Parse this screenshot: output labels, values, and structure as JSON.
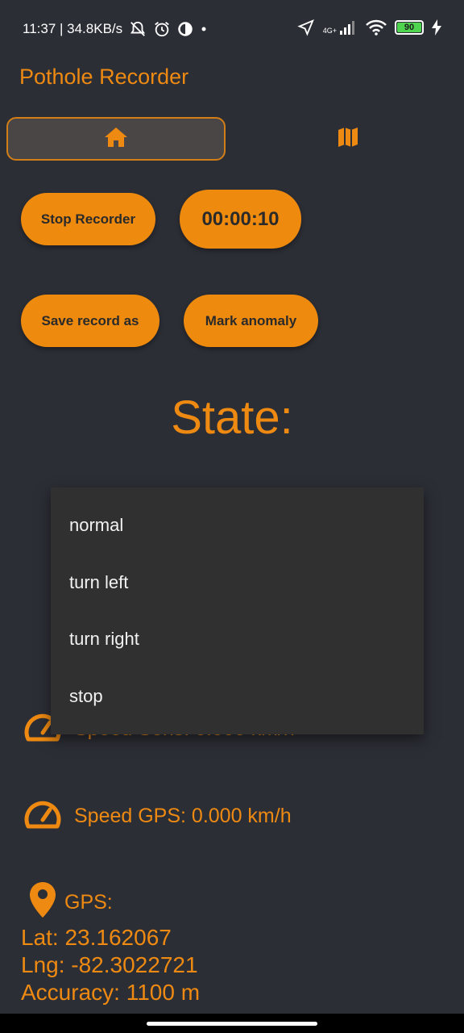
{
  "status_bar": {
    "time_and_speed": "11:37 | 34.8KB/s",
    "network": "4G+",
    "battery": "90"
  },
  "app": {
    "title": "Pothole Recorder",
    "tabs": [
      {
        "icon": "home-icon",
        "selected": true
      },
      {
        "icon": "map-icon",
        "selected": false
      }
    ]
  },
  "controls": {
    "stop_label": "Stop Recorder",
    "timer": "00:00:10",
    "save_label": "Save record as",
    "mark_label": "Mark anomaly"
  },
  "state": {
    "label": "State:"
  },
  "dropdown": {
    "options": [
      "normal",
      "turn left",
      "turn right",
      "stop"
    ]
  },
  "readings": {
    "speed_sensor": "Speed Sens:  0.000  km/h",
    "speed_gps": "Speed GPS:  0.000  km/h",
    "gps_label": "GPS:",
    "lat": "Lat:  23.162067",
    "lng": "Lng:  -82.3022721",
    "accuracy": "Accuracy: 1100 m"
  },
  "colors": {
    "accent": "#ee8a12",
    "background": "#2c2e36",
    "menu_background": "#303030"
  }
}
